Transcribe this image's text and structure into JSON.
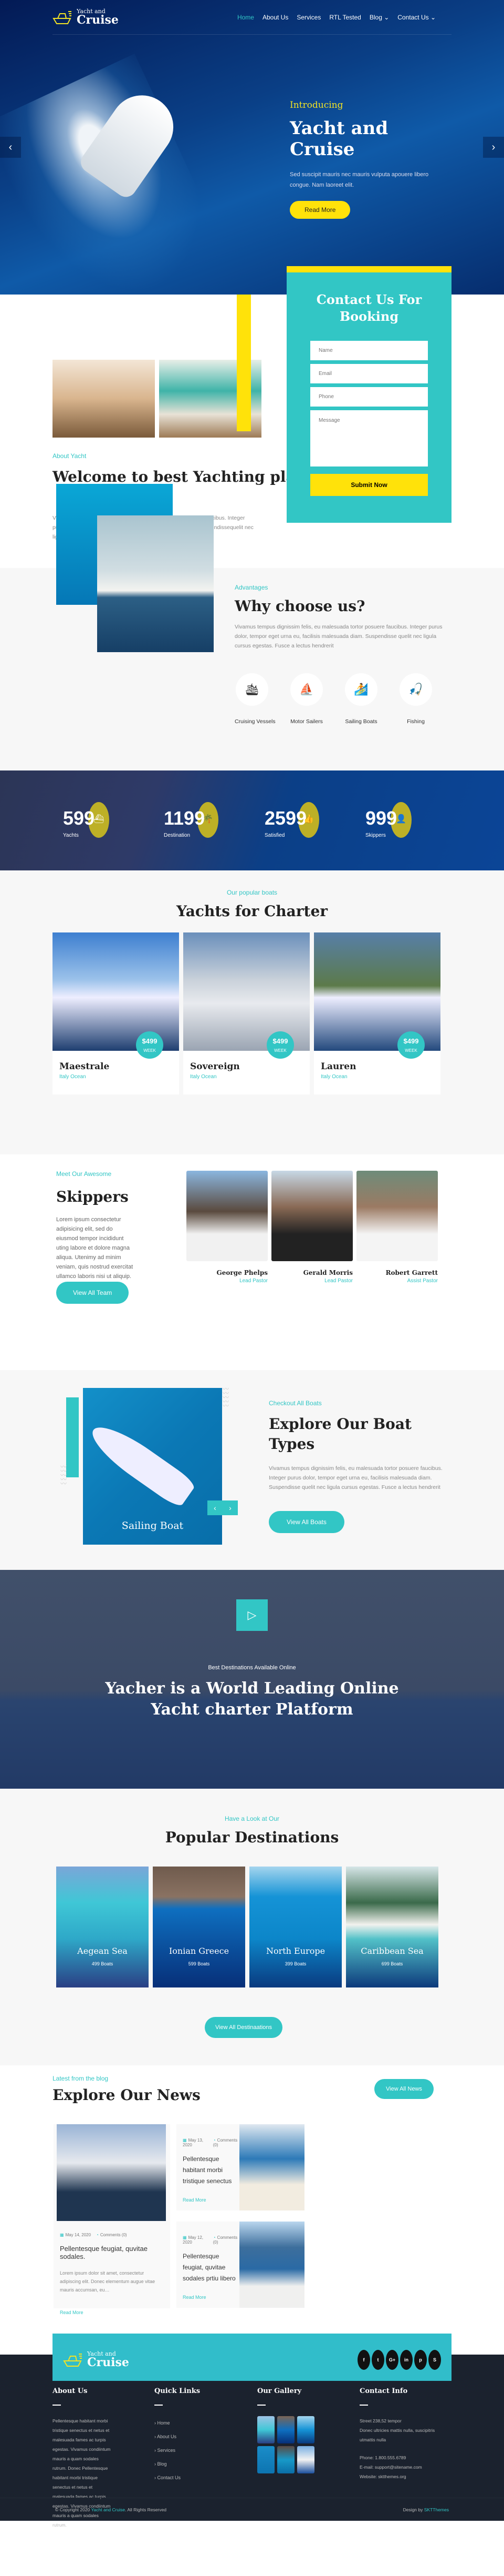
{
  "nav": {
    "logo_small": "Yacht and",
    "logo_big": "Cruise",
    "items": [
      {
        "label": "Home",
        "active": true
      },
      {
        "label": "About Us"
      },
      {
        "label": "Services"
      },
      {
        "label": "RTL Tested"
      },
      {
        "label": "Blog ⌄"
      },
      {
        "label": "Contact Us ⌄"
      }
    ]
  },
  "hero": {
    "intro": "Introducing",
    "title": "Yacht and Cruise",
    "text": "Sed suscipit mauris nec mauris vulputa apouere libero congue. Nam laoreet elit.",
    "button": "Read More",
    "prev_icon": "‹",
    "next_icon": "›"
  },
  "about": {
    "tag": "About Yacht",
    "title": "Welcome to best Yachting platform",
    "text": "Vivamus tempus dignissim felis, eu malesuada tortor posuere faucibus. Integer purus dolor, tempor eget urna eu, facilisis malesuada diam. Suspendissequelit nec ligula cursus egestas. Fusce a lectus hendrerit"
  },
  "booking": {
    "title": "Contact Us For Booking",
    "name_placeholder": "Name",
    "email_placeholder": "Email",
    "phone_placeholder": "Phone",
    "message_placeholder": "Message",
    "submit": "Submit Now"
  },
  "why": {
    "tag": "Advantages",
    "title": "Why choose us?",
    "text": "Vivamus tempus dignissim felis, eu malesuada tortor posuere faucibus. Integer purus dolor, tempor eget urna eu, facilisis malesuada diam. Suspendisse quelit nec ligula cursus egestas. Fusce a lectus hendrerit",
    "features": [
      {
        "label": "Cruising Vessels",
        "icon": "🛳"
      },
      {
        "label": "Motor Sailers",
        "icon": "⛵"
      },
      {
        "label": "Sailing Boats",
        "icon": "🏄"
      },
      {
        "label": "Fishing",
        "icon": "🎣"
      }
    ]
  },
  "stats": [
    {
      "value": "599",
      "label": "Yachts",
      "icon": "⛴"
    },
    {
      "value": "1199",
      "label": "Destination",
      "icon": "🌴"
    },
    {
      "value": "2599",
      "label": "Satisfied",
      "icon": "👍"
    },
    {
      "value": "999",
      "label": "Skippers",
      "icon": "👤"
    }
  ],
  "yachts": {
    "tag": "Our popular boats",
    "title": "Yachts for Charter",
    "cards": [
      {
        "name": "Maestrale",
        "location": "Italy Ocean",
        "price": "$499",
        "period": "WEEK"
      },
      {
        "name": "Sovereign",
        "location": "Italy Ocean",
        "price": "$499",
        "period": "WEEK"
      },
      {
        "name": "Lauren",
        "location": "Italy Ocean",
        "price": "$499",
        "period": "WEEK"
      }
    ]
  },
  "skippers": {
    "tag": "Meet Our Awesome",
    "title": "Skippers",
    "text": "Lorem ipsum consectetur adipisicing elit, sed do eiusmod tempor incididunt uting labore et dolore magna aliqua. Utenimy ad minim veniam, quis nostrud exercitat ullamco laboris nisi ut aliquip.",
    "button": "View All Team",
    "people": [
      {
        "name": "George Phelps",
        "role": "Lead Pastor"
      },
      {
        "name": "Gerald Morris",
        "role": "Lead Pastor"
      },
      {
        "name": "Robert Garrett",
        "role": "Assist Pastor"
      }
    ]
  },
  "explore": {
    "tag": "Checkout All Boats",
    "title": "Explore Our Boat Types",
    "text": "Vivamus tempus dignissim felis, eu malesuada tortor posuere faucibus. Integer purus dolor, tempor eget urna eu, facilisis malesuada diam. Suspendisse quelit nec ligula cursus egestas. Fusce a lectus hendrerit",
    "button": "View All Boats",
    "slide_caption": "Sailing Boat"
  },
  "video": {
    "subtitle": "Best Destinations Available Online",
    "title": "Yacher is a World Leading Online Yacht charter Platform"
  },
  "destinations": {
    "tag": "Have a Look at Our",
    "title": "Popular Destinations",
    "button": "View All Destinaations",
    "items": [
      {
        "name": "Aegean Sea",
        "count": "499 Boats"
      },
      {
        "name": "Ionian Greece",
        "count": "599 Boats"
      },
      {
        "name": "North Europe",
        "count": "399 Boats"
      },
      {
        "name": "Caribbean Sea",
        "count": "699 Boats"
      }
    ]
  },
  "news": {
    "tag": "Latest from the blog",
    "title": "Explore Our News",
    "button": "View All News",
    "read_more": "Read More",
    "main": {
      "date": "May 14, 2020",
      "comments": "Comments (0)",
      "title": "Pellentesque feugiat, quvitae sodales.",
      "excerpt": "Lorem ipsum dolor sit amet, consectetur adipiscing elit. Donec elementum augue vitae mauris accumsan, eu…"
    },
    "side": [
      {
        "date": "May 13, 2020",
        "comments": "Comments (0)",
        "title": "Pellentesque habitant morbi tristique senectus"
      },
      {
        "date": "May 12, 2020",
        "comments": "Comments (0)",
        "title": "Pellentesque feugiat, quvitae sodales prtiu libero"
      }
    ]
  },
  "social": [
    "f",
    "t",
    "G+",
    "in",
    "p",
    "S"
  ],
  "footer": {
    "about_title": "About Us",
    "about_text": "Pellentesque habitant morbi tristique senectus et netus et malesuada fames ac turpis egestas. Vivamus condiintum mauris a quam sodales rutrum. Donec Pellentesque habitant morbi tristique senectus et netus et malesuada fames ac turpis egestas. Vivamus condiintum mauris a quam sodales rutrum.",
    "links_title": "Quick Links",
    "links": [
      "Home",
      "About Us",
      "Services",
      "Blog",
      "Contact Us"
    ],
    "gallery_title": "Our Gallery",
    "contact_title": "Contact Info",
    "address1": "Street 238,52 tempor",
    "address2": "Donec ultricies mattis nulla, suscipitris utmattis nulla",
    "phone": "Phone: 1.800.555.6789",
    "email": "E-mail: support@sitename.com",
    "website": "Website: sktthemes.org",
    "copyright_pre": "© Copyright 2020 ",
    "copyright_link": "Yacht and Cruise",
    "copyright_post": ". All Rights Reserved",
    "design_pre": "Design by ",
    "design_link": "SKTThemes"
  }
}
